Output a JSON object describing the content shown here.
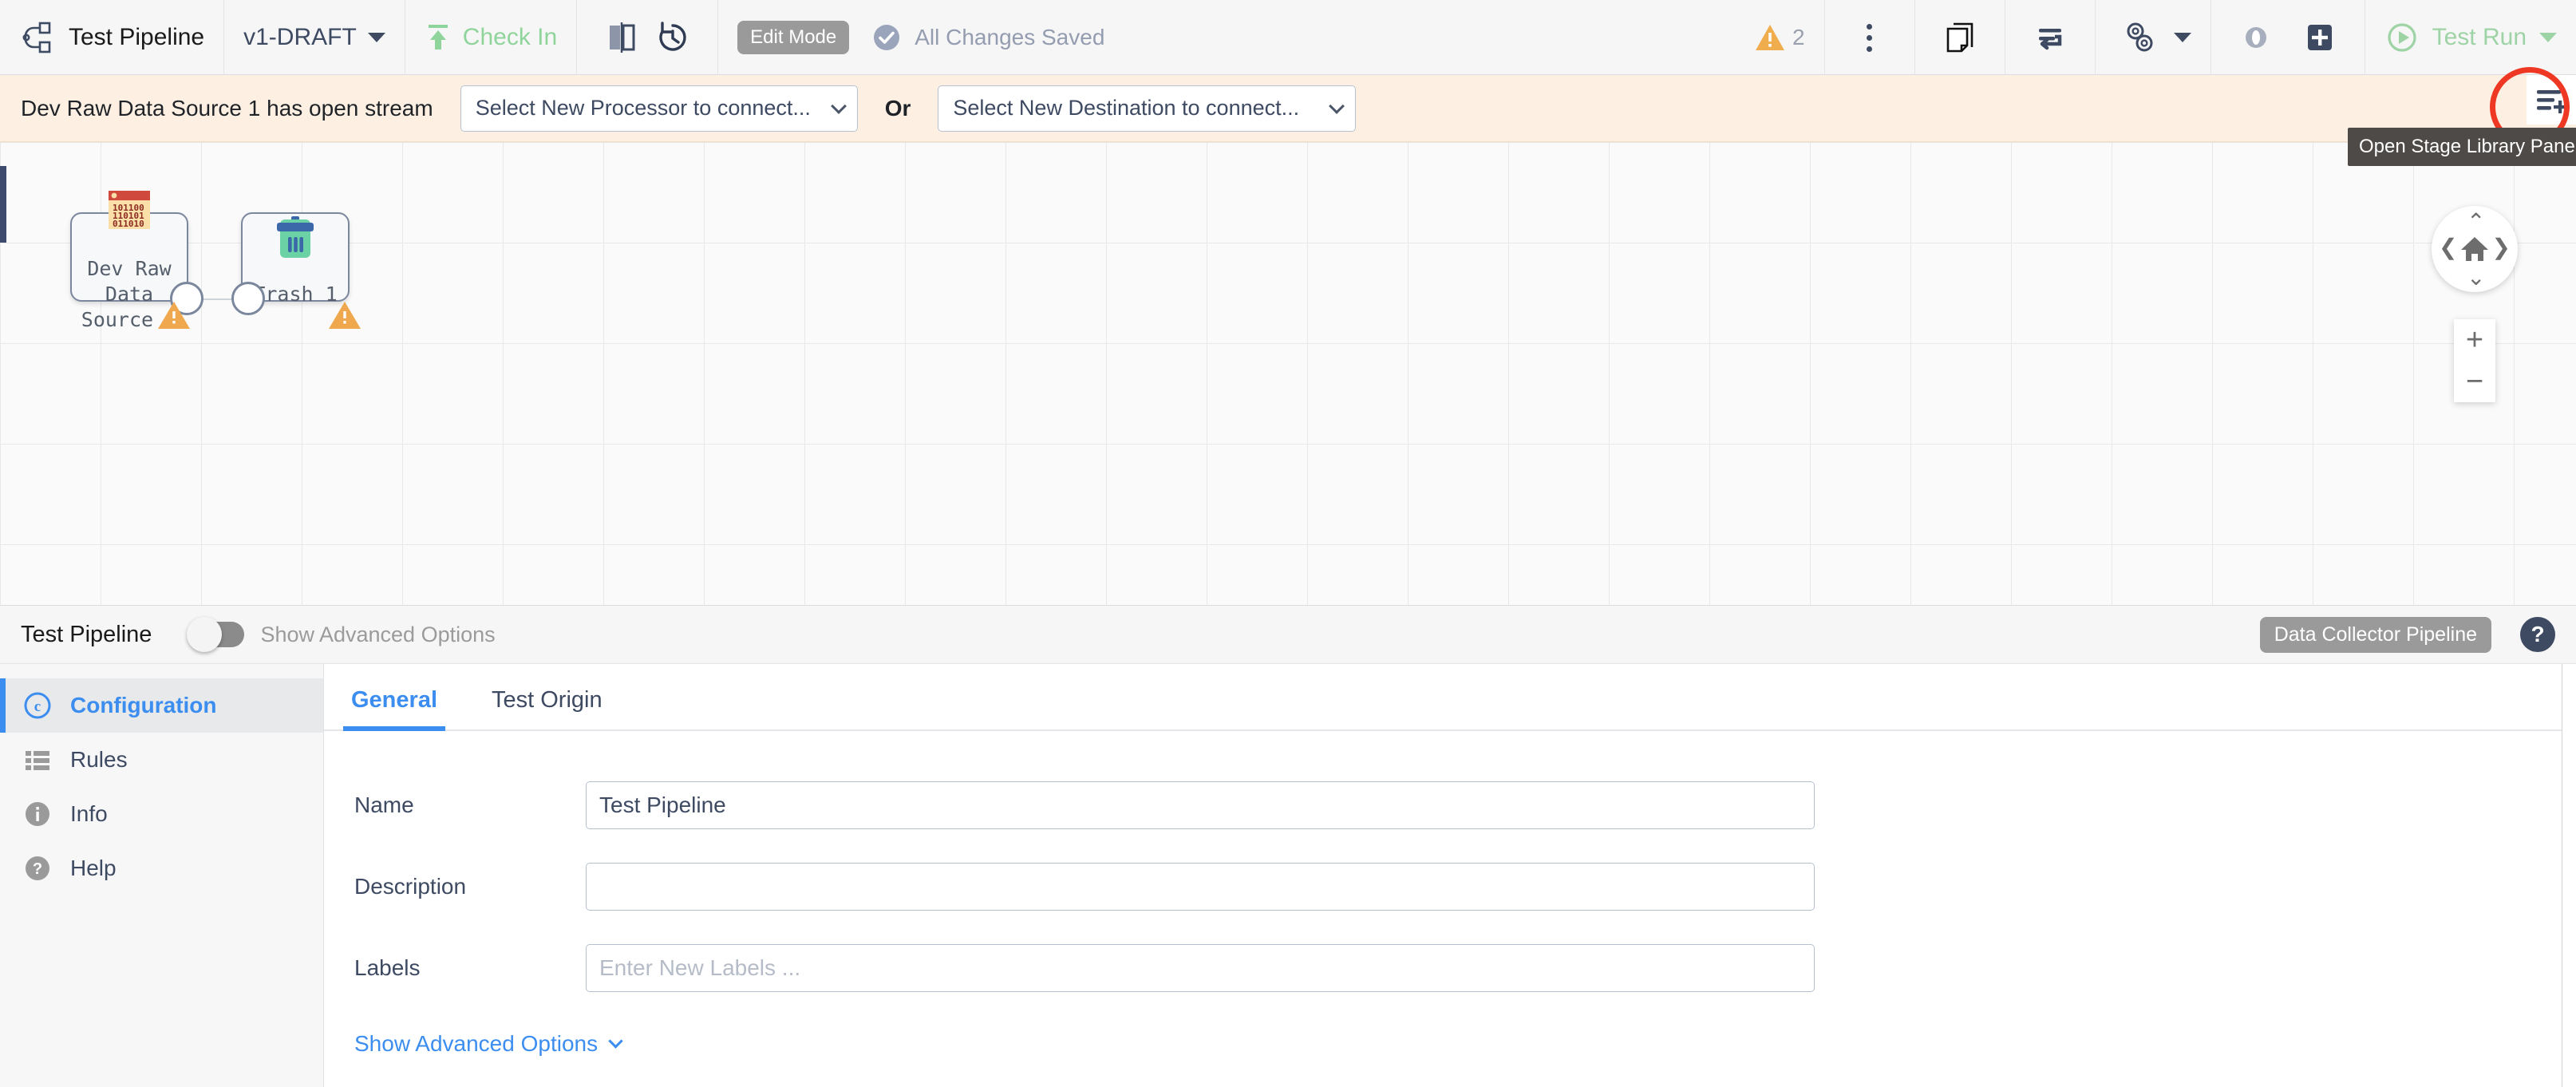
{
  "toolbar": {
    "pipeline_icon": "pipeline-icon",
    "title": "Test Pipeline",
    "version": "v1-DRAFT",
    "check_in": "Check In",
    "compare_icon": "compare-versions-icon",
    "history_icon": "history-icon",
    "edit_mode": "Edit Mode",
    "saved_status": "All Changes Saved",
    "warning_count": "2",
    "warning_icon": "warning-triangle-icon",
    "kebab_icon": "more-options-icon",
    "duplicate_icon": "duplicate-icon",
    "preview_list_icon": "snapshot-icon",
    "gears_icon": "gears-icon",
    "eye_icon": "preview-icon",
    "plus_icon": "add-icon",
    "test_run": "Test Run",
    "play_icon": "play-icon"
  },
  "notification": {
    "message": "Dev Raw Data Source 1 has open stream",
    "processor_select": "Select New Processor to connect...",
    "or_label": "Or",
    "destination_select": "Select New Destination to connect..."
  },
  "stage_library": {
    "button_icon": "open-stage-library-icon",
    "tooltip": "Open Stage Library Panel"
  },
  "canvas": {
    "nodes": [
      {
        "label": "Dev Raw Data\nSource 1",
        "icon": "dev-raw-data-source-icon",
        "warning": true
      },
      {
        "label": "Trash 1",
        "icon": "trash-icon",
        "warning": true
      }
    ],
    "nav": {
      "home_icon": "home-icon",
      "up_icon": "chevron-up-icon",
      "down_icon": "chevron-down-icon",
      "left_icon": "chevron-left-icon",
      "right_icon": "chevron-right-icon",
      "zoom_in": "+",
      "zoom_out": "−"
    }
  },
  "panel_header": {
    "title": "Test Pipeline",
    "advanced_toggle_label": "Show Advanced Options",
    "advanced_toggle_on": false,
    "pipeline_type_chip": "Data Collector Pipeline",
    "help_icon": "?"
  },
  "sidebar": {
    "items": [
      {
        "label": "Configuration",
        "icon": "configuration-icon",
        "active": true
      },
      {
        "label": "Rules",
        "icon": "rules-icon",
        "active": false
      },
      {
        "label": "Info",
        "icon": "info-icon",
        "active": false
      },
      {
        "label": "Help",
        "icon": "help-icon",
        "active": false
      }
    ]
  },
  "form": {
    "tabs": [
      {
        "label": "General",
        "active": true
      },
      {
        "label": "Test Origin",
        "active": false
      }
    ],
    "fields": [
      {
        "label": "Name",
        "value": "Test Pipeline",
        "placeholder": ""
      },
      {
        "label": "Description",
        "value": "",
        "placeholder": ""
      },
      {
        "label": "Labels",
        "value": "",
        "placeholder": "Enter New Labels ..."
      }
    ],
    "show_advanced": "Show Advanced Options"
  },
  "colors": {
    "accent_blue": "#3c8df0",
    "notif_bg": "#fdf0e3",
    "warning_orange": "#efa84d",
    "green": "#9ed3a5",
    "highlight_red": "#ee3823",
    "dark_navy": "#3d4a62"
  }
}
